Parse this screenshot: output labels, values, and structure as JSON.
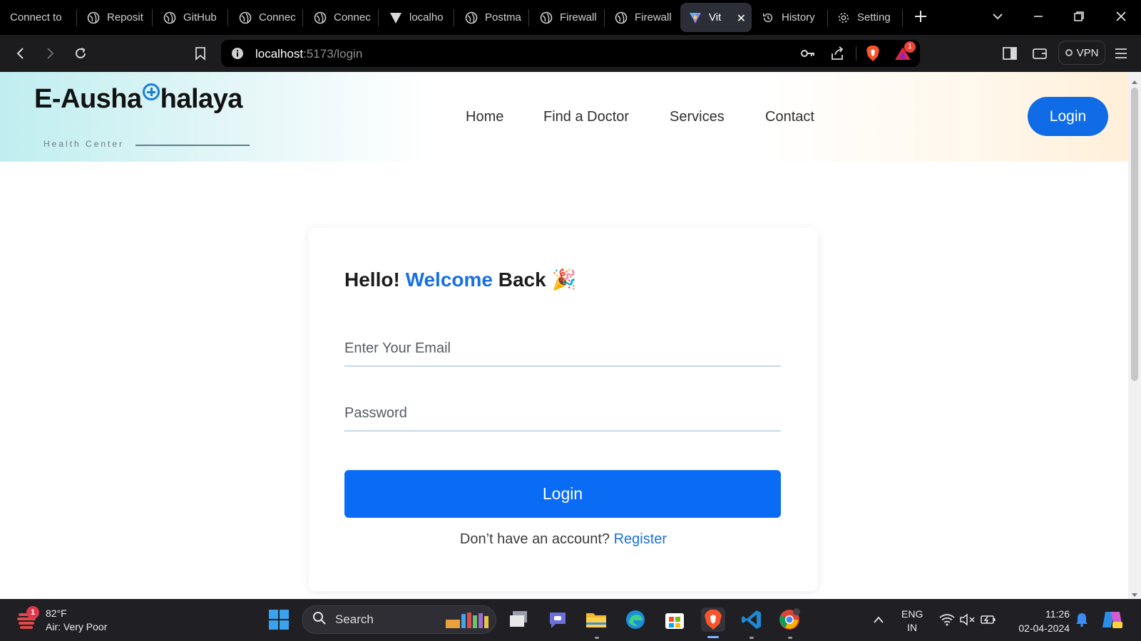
{
  "browser": {
    "tabs": [
      {
        "label": "Connect to",
        "icon": "globe-icon"
      },
      {
        "label": "Reposit",
        "icon": "globe-icon"
      },
      {
        "label": "GitHub",
        "icon": "globe-icon"
      },
      {
        "label": "Connec",
        "icon": "globe-icon"
      },
      {
        "label": "Connec",
        "icon": "globe-icon"
      },
      {
        "label": "localho",
        "icon": "vite-icon"
      },
      {
        "label": "Postma",
        "icon": "globe-icon"
      },
      {
        "label": "Firewall",
        "icon": "globe-icon"
      },
      {
        "label": "Firewall",
        "icon": "globe-icon"
      },
      {
        "label": "Vit",
        "icon": "vite-icon",
        "active": true
      },
      {
        "label": "History",
        "icon": "history-icon"
      },
      {
        "label": "Setting",
        "icon": "gear-icon"
      }
    ],
    "address": {
      "host": "localhost",
      "rest": ":5173/login"
    },
    "vpn_label": "VPN",
    "alert_badge": "1",
    "accent_color": "#2b2e36"
  },
  "site": {
    "logo_left": "E-Ausha",
    "logo_right": "halaya",
    "tagline": "Health Center",
    "nav": [
      "Home",
      "Find a Doctor",
      "Services",
      "Contact"
    ],
    "login_button": "Login",
    "brand_color": "#0f6ce6"
  },
  "login_card": {
    "greeting_start": "Hello!",
    "greeting_accent": "Welcome",
    "greeting_end": "Back",
    "greeting_emoji": "🎉",
    "email_placeholder": "Enter Your Email",
    "email_value": "",
    "password_placeholder": "Password",
    "password_value": "",
    "submit_label": "Login",
    "register_prompt": "Don’t have an account?",
    "register_link": "Register"
  },
  "taskbar": {
    "weather_badge": "1",
    "temperature": "82°F",
    "air_quality": "Air: Very Poor",
    "search_label": "Search",
    "language_top": "ENG",
    "language_bottom": "IN",
    "time": "11:26",
    "date": "02-04-2024"
  }
}
